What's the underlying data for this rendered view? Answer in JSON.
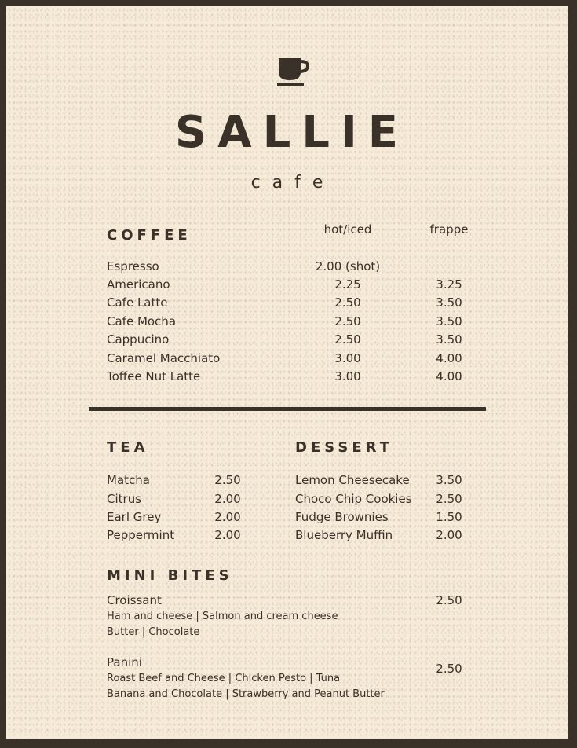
{
  "brand": {
    "name": "SALLIE",
    "subtitle": "cafe",
    "logo_icon": "coffee-cup-icon"
  },
  "coffee": {
    "heading": "COFFEE",
    "columns": [
      "hot/iced",
      "frappe"
    ],
    "items": [
      {
        "name": "Espresso",
        "hot": "2.00 (shot)",
        "frappe": ""
      },
      {
        "name": "Americano",
        "hot": "2.25",
        "frappe": "3.25"
      },
      {
        "name": "Cafe Latte",
        "hot": "2.50",
        "frappe": "3.50"
      },
      {
        "name": "Cafe Mocha",
        "hot": "2.50",
        "frappe": "3.50"
      },
      {
        "name": "Cappucino",
        "hot": "2.50",
        "frappe": "3.50"
      },
      {
        "name": "Caramel Macchiato",
        "hot": "3.00",
        "frappe": "4.00"
      },
      {
        "name": "Toffee Nut Latte",
        "hot": "3.00",
        "frappe": "4.00"
      }
    ]
  },
  "tea": {
    "heading": "TEA",
    "items": [
      {
        "name": "Matcha",
        "price": "2.50"
      },
      {
        "name": "Citrus",
        "price": "2.00"
      },
      {
        "name": "Earl Grey",
        "price": "2.00"
      },
      {
        "name": "Peppermint",
        "price": "2.00"
      }
    ]
  },
  "dessert": {
    "heading": "DESSERT",
    "items": [
      {
        "name": "Lemon Cheesecake",
        "price": "3.50"
      },
      {
        "name": "Choco Chip Cookies",
        "price": "2.50"
      },
      {
        "name": "Fudge Brownies",
        "price": "1.50"
      },
      {
        "name": "Blueberry Muffin",
        "price": "2.00"
      }
    ]
  },
  "mini_bites": {
    "heading": "MINI BITES",
    "items": [
      {
        "name": "Croissant",
        "price": "2.50",
        "lines": [
          "Ham and cheese | Salmon and cream cheese",
          "Butter | Chocolate"
        ]
      },
      {
        "name": "Panini",
        "price": "2.50",
        "lines": [
          "Roast Beef and Cheese | Chicken Pesto | Tuna",
          "Banana and Chocolate | Strawberry and Peanut Butter"
        ]
      }
    ]
  },
  "colors": {
    "ink": "#3a3128",
    "paper": "#f6ead8"
  }
}
